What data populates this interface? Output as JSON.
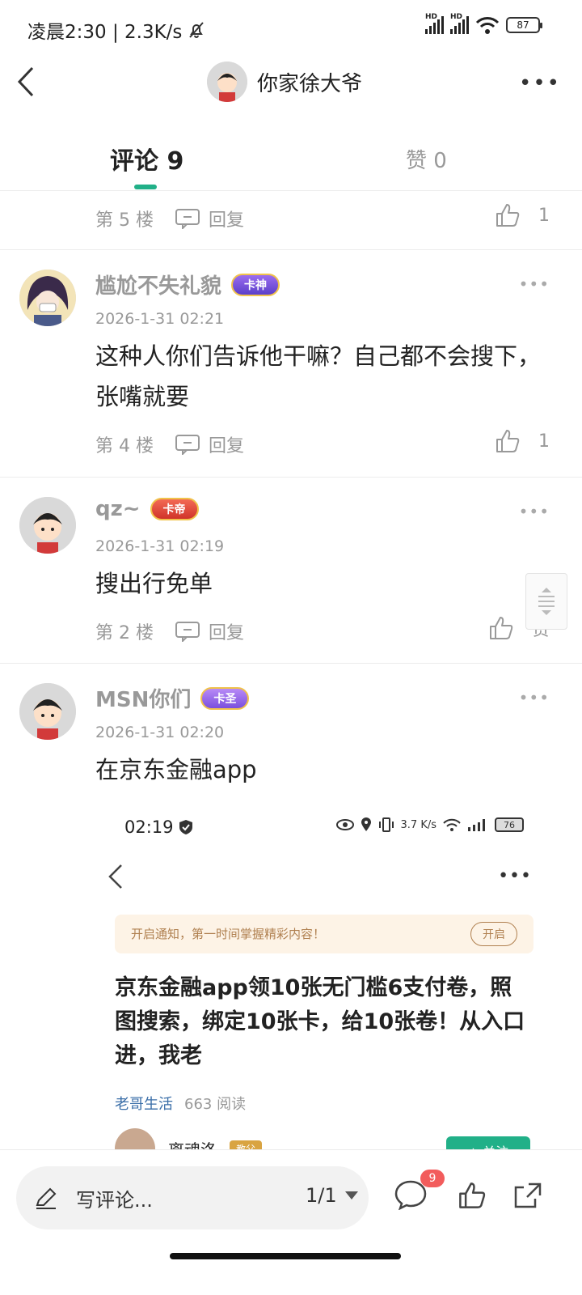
{
  "status_bar": {
    "time_speed": "凌晨2:30 | 2.3K/s",
    "hd1": "HD",
    "hd2": "HD",
    "battery": "87"
  },
  "header": {
    "title": "你家徐大爷"
  },
  "tabs": {
    "comments": "评论 9",
    "likes": "赞 0"
  },
  "comments": [
    {
      "floor": "第 5 楼",
      "reply": "回复",
      "likes": "1"
    },
    {
      "name": "尴尬不失礼貌",
      "badge": "卡神",
      "time": "2026-1-31 02:21",
      "text": "这种人你们告诉他干嘛？自己都不会搜下，张嘴就要",
      "floor": "第 4 楼",
      "reply": "回复",
      "likes": "1"
    },
    {
      "name": "qz~",
      "badge": "卡帝",
      "time": "2026-1-31 02:19",
      "text": "搜出行免单",
      "floor": "第 2 楼",
      "reply": "回复",
      "likes": "赞"
    },
    {
      "name": "MSN你们",
      "badge": "卡圣",
      "time": "2026-1-31 02:20",
      "text": "在京东金融app"
    }
  ],
  "embedded": {
    "time": "02:19",
    "net_speed": "3.7 K/s",
    "battery": "76",
    "notice": "开启通知，第一时间掌握精彩内容！",
    "notice_btn": "开启",
    "title": "京东金融app领10张无门槛6支付卷，照图搜索，绑定10张卡，给10张卷！从入口进，我老",
    "author": "老哥生活",
    "reads": "663 阅读",
    "user": "离魂洛",
    "user_badge": "教父",
    "follow": "+ 关注"
  },
  "bottom_bar": {
    "write_placeholder": "写评论...",
    "page": "1/1",
    "comment_count": "9"
  },
  "colors": {
    "accent": "#21b088",
    "badge_red": "#f25c5c"
  }
}
